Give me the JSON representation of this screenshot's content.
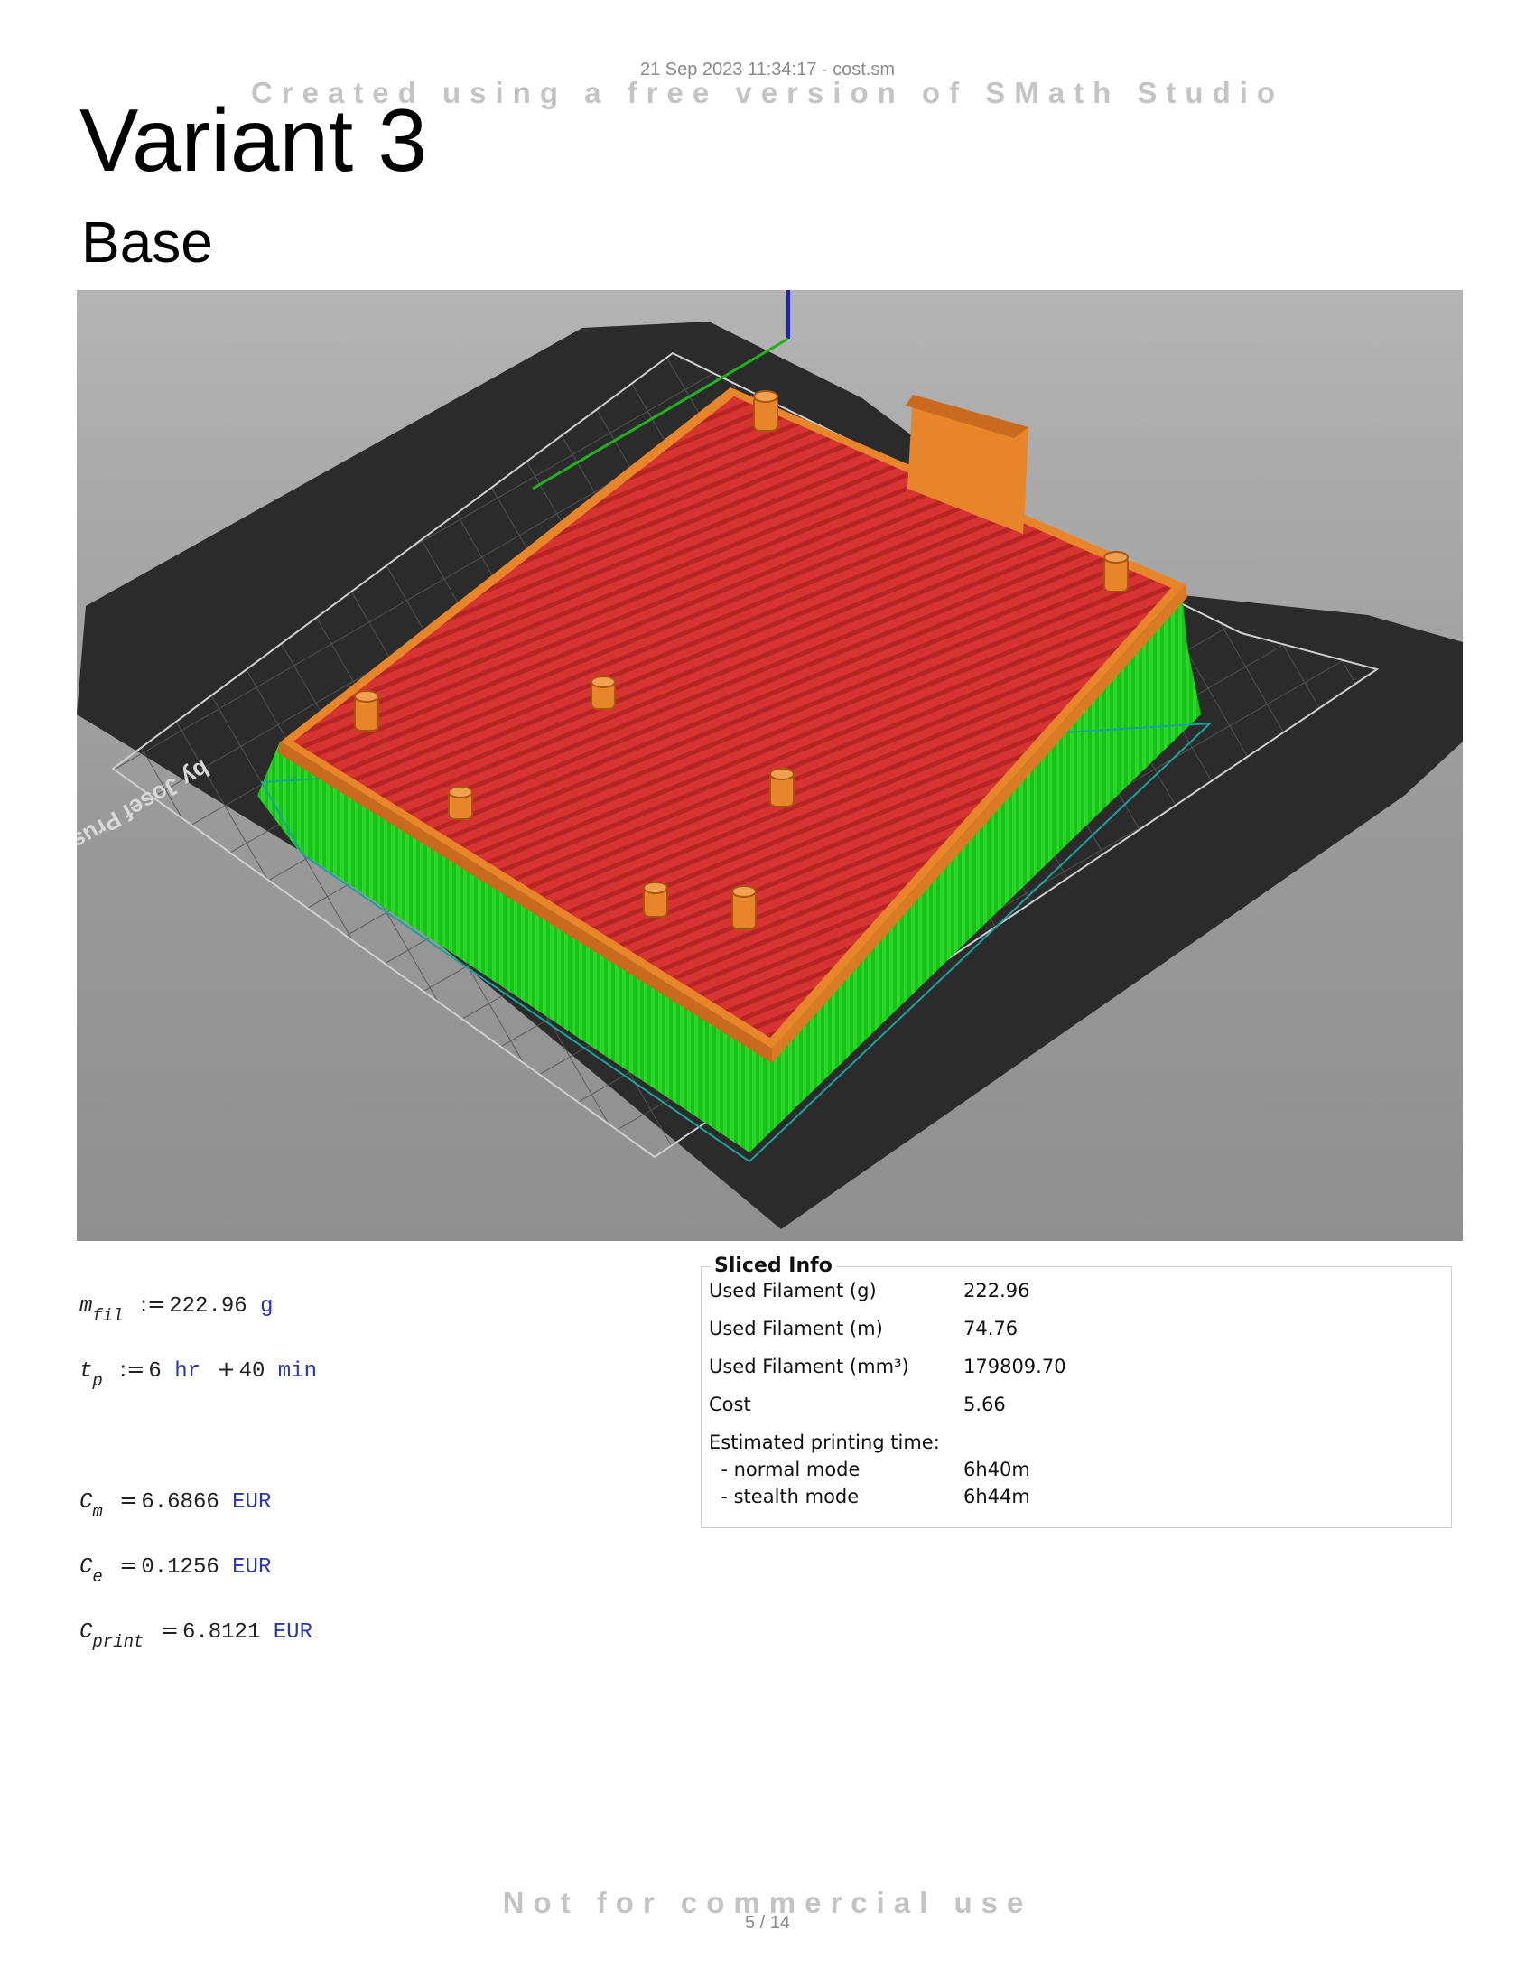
{
  "header": {
    "date_file": "21 Sep 2023 11:34:17 - cost.sm",
    "watermark": "Created using a free version of SMath Studio"
  },
  "document": {
    "title": "Variant 3",
    "subtitle": "Base"
  },
  "render": {
    "bed_text": "by Josef Prusa",
    "colors": {
      "background_top": "#b4b4b4",
      "bed": "#2b2b2b",
      "top_surface": "#d63333",
      "perimeter": "#e8852a",
      "support": "#22d922",
      "axis_z": "#1a22c8",
      "axis_y": "#22b022"
    }
  },
  "math": {
    "m_fil": {
      "var": "m",
      "sub": "fil",
      "op": ":=",
      "value": "222.96",
      "unit": "g"
    },
    "t_p": {
      "var": "t",
      "sub": "p",
      "op": ":=",
      "hr": "6",
      "hr_unit": "hr",
      "plus": "+",
      "min": "40",
      "min_unit": "min"
    },
    "C_m": {
      "var": "C",
      "sub": "m",
      "op": "=",
      "value": "6.6866",
      "unit": "EUR"
    },
    "C_e": {
      "var": "C",
      "sub": "e",
      "op": "=",
      "value": "0.1256",
      "unit": "EUR"
    },
    "C_print": {
      "var": "C",
      "sub": "print",
      "op": "=",
      "value": "6.8121",
      "unit": "EUR"
    }
  },
  "sliced_info": {
    "title": "Sliced Info",
    "rows": [
      {
        "label": "Used Filament (g)",
        "value": "222.96"
      },
      {
        "label": "Used Filament (m)",
        "value": "74.76"
      },
      {
        "label": "Used Filament (mm³)",
        "value": "179809.70"
      },
      {
        "label": "Cost",
        "value": "5.66"
      },
      {
        "label": "Estimated printing time:",
        "value": ""
      },
      {
        "label": "  - normal mode",
        "value": "6h40m"
      },
      {
        "label": "  - stealth mode",
        "value": "6h44m"
      }
    ]
  },
  "footer": {
    "watermark": "Not for commercial use",
    "page": "5 / 14"
  }
}
